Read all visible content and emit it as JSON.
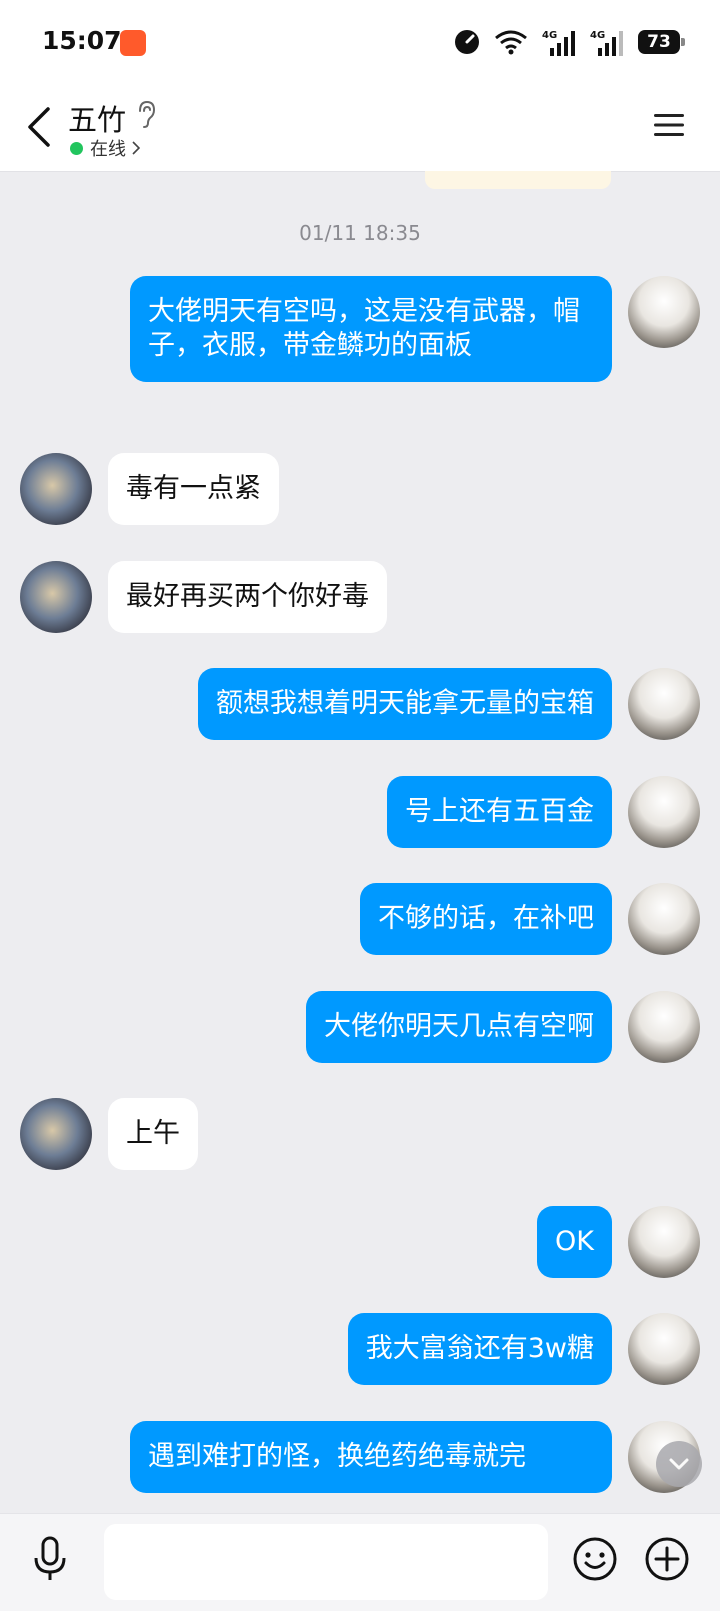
{
  "status_bar": {
    "time": "15:07",
    "battery": "73",
    "network": "4G"
  },
  "header": {
    "contact_name": "五竹",
    "presence": "在线"
  },
  "chat": {
    "timestamp": "01/11 18:35",
    "messages": [
      {
        "from": "me",
        "text": "大佬明天有空吗，这是没有武器，帽子，衣服，带金鳞功的面板"
      },
      {
        "from": "peer",
        "text": "毒有一点紧"
      },
      {
        "from": "peer",
        "text": "最好再买两个你好毒"
      },
      {
        "from": "me",
        "text": "额想我想着明天能拿无量的宝箱"
      },
      {
        "from": "me",
        "text": "号上还有五百金"
      },
      {
        "from": "me",
        "text": "不够的话，在补吧"
      },
      {
        "from": "me",
        "text": "大佬你明天几点有空啊"
      },
      {
        "from": "peer",
        "text": "上午"
      },
      {
        "from": "me",
        "text": "OK"
      },
      {
        "from": "me",
        "text": "我大富翁还有3w糖"
      },
      {
        "from": "me",
        "text": "遇到难打的怪，换绝药绝毒就完"
      }
    ]
  },
  "input": {
    "placeholder": ""
  },
  "colors": {
    "sent_bubble": "#0099ff",
    "received_bubble": "#ffffff",
    "background": "#ededf0",
    "online": "#22c55e"
  }
}
